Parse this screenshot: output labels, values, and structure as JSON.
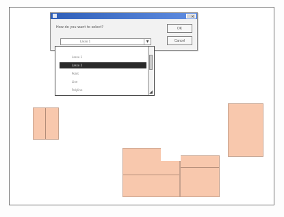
{
  "dialog": {
    "prompt": "How do you want to select?",
    "ok_label": "OK",
    "cancel_label": "Cancel",
    "close_glyph": "×"
  },
  "combo": {
    "value": "Lasso 1",
    "arrow_glyph": "▼"
  },
  "dropdown": {
    "items": [
      "Lasso 1",
      "Lasso 2",
      "Point",
      "Line",
      "Polyline"
    ],
    "selected_index": 1
  },
  "icons": {
    "resize_grip": "◢"
  }
}
